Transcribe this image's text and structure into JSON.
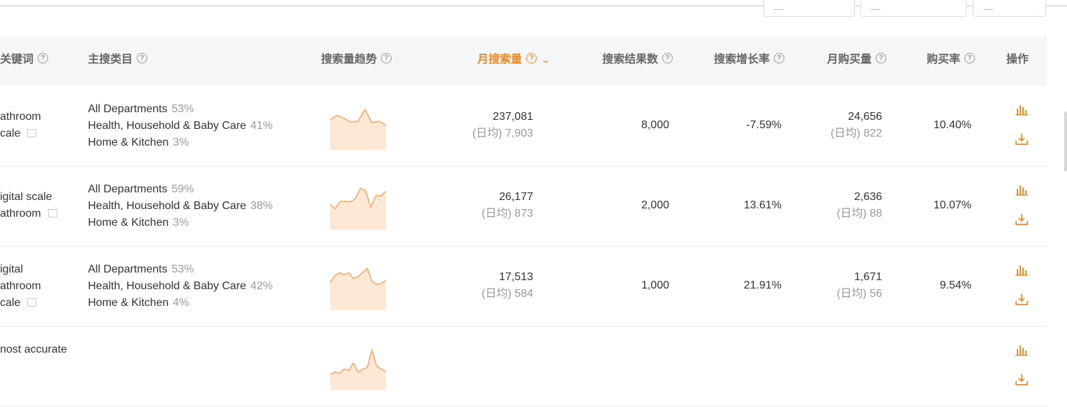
{
  "columns": {
    "keyword": "关键词",
    "category": "主搜类目",
    "trend": "搜索量趋势",
    "monthly_search": "月搜索量",
    "result_count": "搜索结果数",
    "growth": "搜索增长率",
    "monthly_purchase": "月购买量",
    "purchase_rate": "购买率",
    "actions": "操作"
  },
  "help_icon_glyph": "?",
  "colors": {
    "accent": "#f08a24",
    "header_bg": "#f5f6f8",
    "muted": "#999999"
  },
  "rows": [
    {
      "keyword_lines": [
        "athroom",
        "cale"
      ],
      "categories": [
        {
          "name": "All Departments",
          "pct": "53%"
        },
        {
          "name": "Health, Household & Baby Care",
          "pct": "41%"
        },
        {
          "name": "Home & Kitchen",
          "pct": "3%"
        }
      ],
      "trend": [
        0.6,
        0.75,
        0.65,
        0.52,
        0.55,
        0.95,
        0.5,
        0.55,
        0.42
      ],
      "monthly_search": "237,081",
      "monthly_search_daily": "(日均) 7,903",
      "result_count": "8,000",
      "growth": "-7.59%",
      "monthly_purchase": "24,656",
      "monthly_purchase_daily": "(日均) 822",
      "purchase_rate": "10.40%"
    },
    {
      "keyword_lines": [
        "igital scale",
        "athroom"
      ],
      "categories": [
        {
          "name": "All Departments",
          "pct": "59%"
        },
        {
          "name": "Health, Household & Baby Care",
          "pct": "38%"
        },
        {
          "name": "Home & Kitchen",
          "pct": "3%"
        }
      ],
      "trend": [
        0.45,
        0.3,
        0.55,
        0.55,
        0.53,
        0.65,
        1.0,
        0.92,
        0.35,
        0.75,
        0.73,
        0.9
      ],
      "monthly_search": "26,177",
      "monthly_search_daily": "(日均) 873",
      "result_count": "2,000",
      "growth": "13.61%",
      "monthly_purchase": "2,636",
      "monthly_purchase_daily": "(日均) 88",
      "purchase_rate": "10.07%"
    },
    {
      "keyword_lines": [
        "igital",
        "athroom",
        "cale"
      ],
      "categories": [
        {
          "name": "All Departments",
          "pct": "53%"
        },
        {
          "name": "Health, Household & Baby Care",
          "pct": "42%"
        },
        {
          "name": "Home & Kitchen",
          "pct": "4%"
        }
      ],
      "trend": [
        0.5,
        0.75,
        0.85,
        0.78,
        0.85,
        0.65,
        0.72,
        0.85,
        1.0,
        0.55,
        0.45,
        0.48,
        0.6
      ],
      "monthly_search": "17,513",
      "monthly_search_daily": "(日均) 584",
      "result_count": "1,000",
      "growth": "21.91%",
      "monthly_purchase": "1,671",
      "monthly_purchase_daily": "(日均) 56",
      "purchase_rate": "9.54%"
    },
    {
      "keyword_lines": [
        "nost accurate"
      ],
      "categories": [],
      "trend": [
        0.1,
        0.2,
        0.15,
        0.3,
        0.25,
        0.5,
        0.2,
        0.3,
        0.35,
        0.95,
        0.4,
        0.3,
        0.2
      ],
      "monthly_search": "",
      "monthly_search_daily": "",
      "result_count": "",
      "growth": "",
      "monthly_purchase": "",
      "monthly_purchase_daily": "",
      "purchase_rate": ""
    }
  ]
}
